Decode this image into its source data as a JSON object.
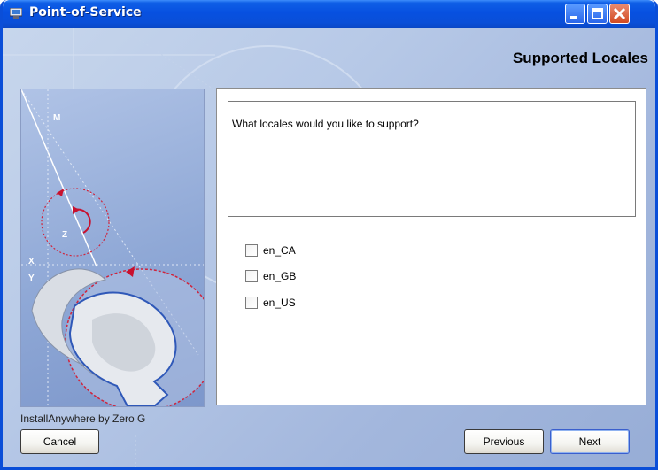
{
  "window": {
    "title": "Point-of-Service",
    "title_icon": "installer-icon",
    "controls": [
      "minimize-icon",
      "maximize-icon",
      "close-icon"
    ]
  },
  "page": {
    "heading": "Supported Locales",
    "prompt": "What locales would you like to support?"
  },
  "locales": [
    {
      "label": "en_CA",
      "checked": false
    },
    {
      "label": "en_GB",
      "checked": false
    },
    {
      "label": "en_US",
      "checked": false
    }
  ],
  "side_graphic": {
    "axis_labels": [
      "M",
      "Z",
      "X",
      "Y"
    ]
  },
  "footer": {
    "vendor": "InstallAnywhere by Zero G"
  },
  "buttons": {
    "cancel": "Cancel",
    "previous": "Previous",
    "next": "Next"
  },
  "colors": {
    "titlebar": "#0a4fd8",
    "close_button": "#d24a22",
    "background": "#b7c9e7"
  }
}
